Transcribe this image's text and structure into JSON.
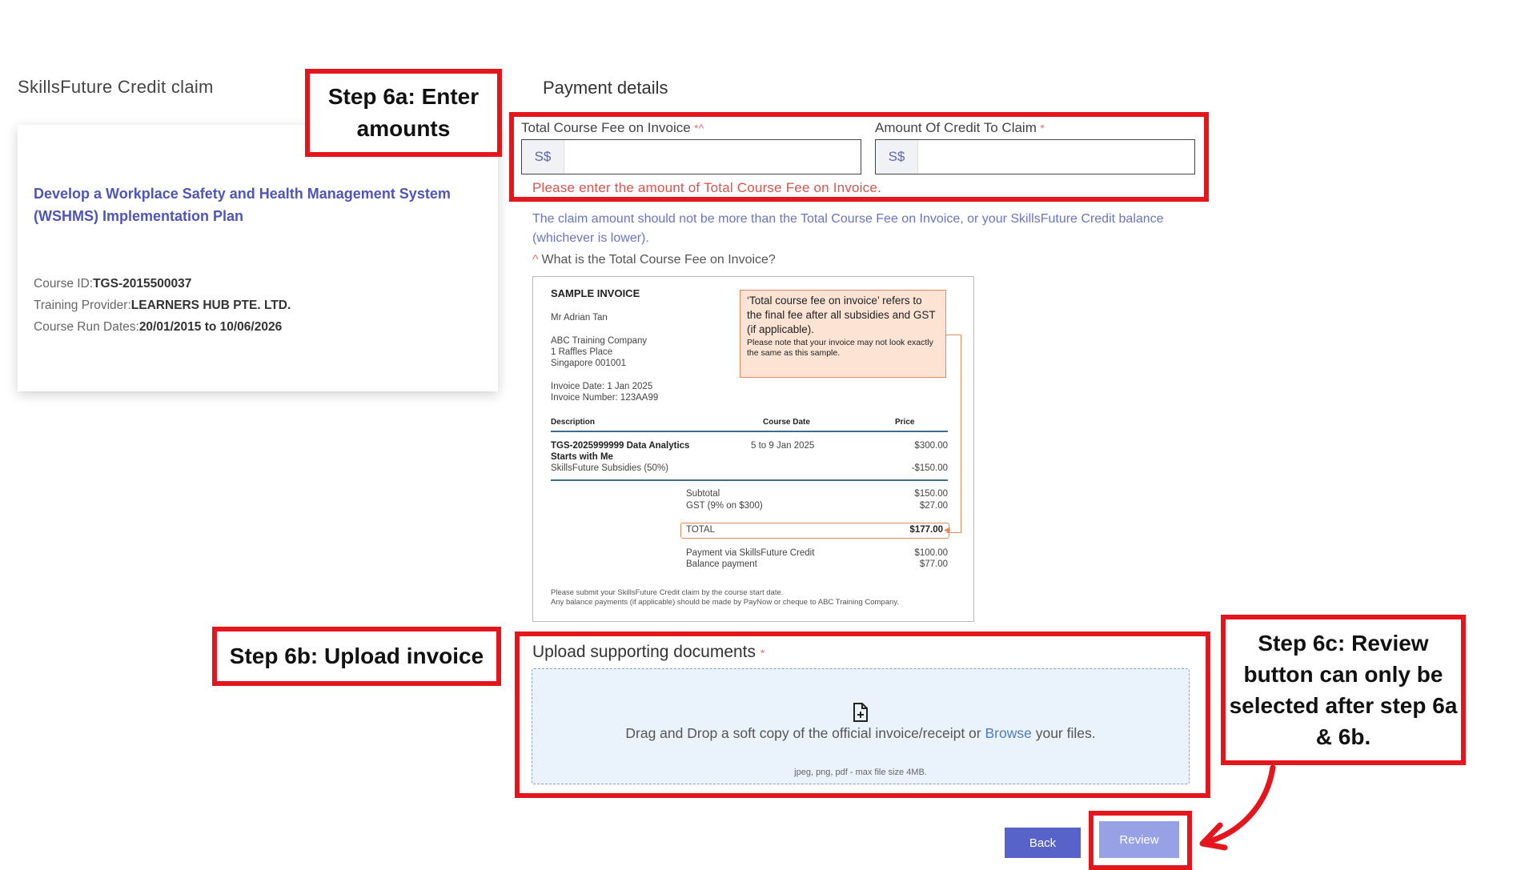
{
  "left": {
    "section_title": "SkillsFuture Credit claim",
    "course_name": "Develop a Workplace Safety and Health Management System (WSHMS) Implementation Plan",
    "course_id_label": "Course ID:",
    "course_id": "TGS-2015500037",
    "provider_label": "Training Provider:",
    "provider": "LEARNERS HUB PTE. LTD.",
    "dates_label": "Course Run Dates:",
    "dates": "20/01/2015 to 10/06/2026"
  },
  "callouts": {
    "step6a": "Step 6a: Enter amounts",
    "step6b": "Step 6b: Upload invoice",
    "step6c": "Step 6c: Review button can only be selected after step 6a & 6b."
  },
  "payment": {
    "title": "Payment details",
    "fee_label": "Total Course Fee on Invoice",
    "fee_marker": "*^",
    "credit_label": "Amount Of Credit To Claim",
    "credit_marker": "*",
    "currency_prefix": "S$",
    "fee_value": "",
    "credit_value": "",
    "error": "Please enter the amount of Total Course Fee on Invoice.",
    "hint": "The claim amount should not be more than the Total Course Fee on Invoice, or your SkillsFuture Credit balance (whichever is lower).",
    "question_marker": "^",
    "question": "What is the Total Course Fee on Invoice?"
  },
  "invoice": {
    "heading": "SAMPLE INVOICE",
    "name": "Mr Adrian Tan",
    "company": "ABC Training Company",
    "address1": "1 Raffles Place",
    "address2": "Singapore 001001",
    "date": "Invoice Date: 1 Jan 2025",
    "number": "Invoice Number: 123AA99",
    "note_main": "‘Total course fee on invoice’ refers to the final fee after all subsidies and GST (if applicable).",
    "note_small": "Please note that your invoice may not look exactly the same as this sample.",
    "col_description": "Description",
    "col_course_date": "Course Date",
    "col_price": "Price",
    "item_title_1": "TGS-2025999999 Data Analytics",
    "item_title_2": "Starts with Me",
    "item_date": "5 to 9 Jan 2025",
    "item_price": "$300.00",
    "subsidy_label": "SkillsFuture Subsidies (50%)",
    "subsidy_value": "-$150.00",
    "subtotal_label": "Subtotal",
    "subtotal_value": "$150.00",
    "gst_label": "GST (9% on $300)",
    "gst_value": "$27.00",
    "total_label": "TOTAL",
    "total_value": "$177.00",
    "sfc_label": "Payment via SkillsFuture Credit",
    "sfc_value": "$100.00",
    "balance_label": "Balance payment",
    "balance_value": "$77.00",
    "footer1": "Please submit your SkillsFuture Credit claim by the course start date.",
    "footer2": "Any balance payments (if applicable) should be made by PayNow or cheque to ABC Training Company."
  },
  "upload": {
    "title": "Upload supporting documents",
    "marker": "*",
    "text_before": "Drag and Drop a soft copy of the official invoice/receipt or ",
    "browse": "Browse",
    "text_after": " your files.",
    "formats": "jpeg, png, pdf - max file size 4MB."
  },
  "buttons": {
    "back": "Back",
    "review": "Review"
  },
  "colors": {
    "callout_red": "#e3161d",
    "primary": "#5863c9",
    "primary_disabled": "#97a2e6",
    "error": "#d9534f",
    "link": "#4f55b8"
  },
  "icons": {
    "upload": "file-plus-icon",
    "arrow": "curved-arrow"
  }
}
